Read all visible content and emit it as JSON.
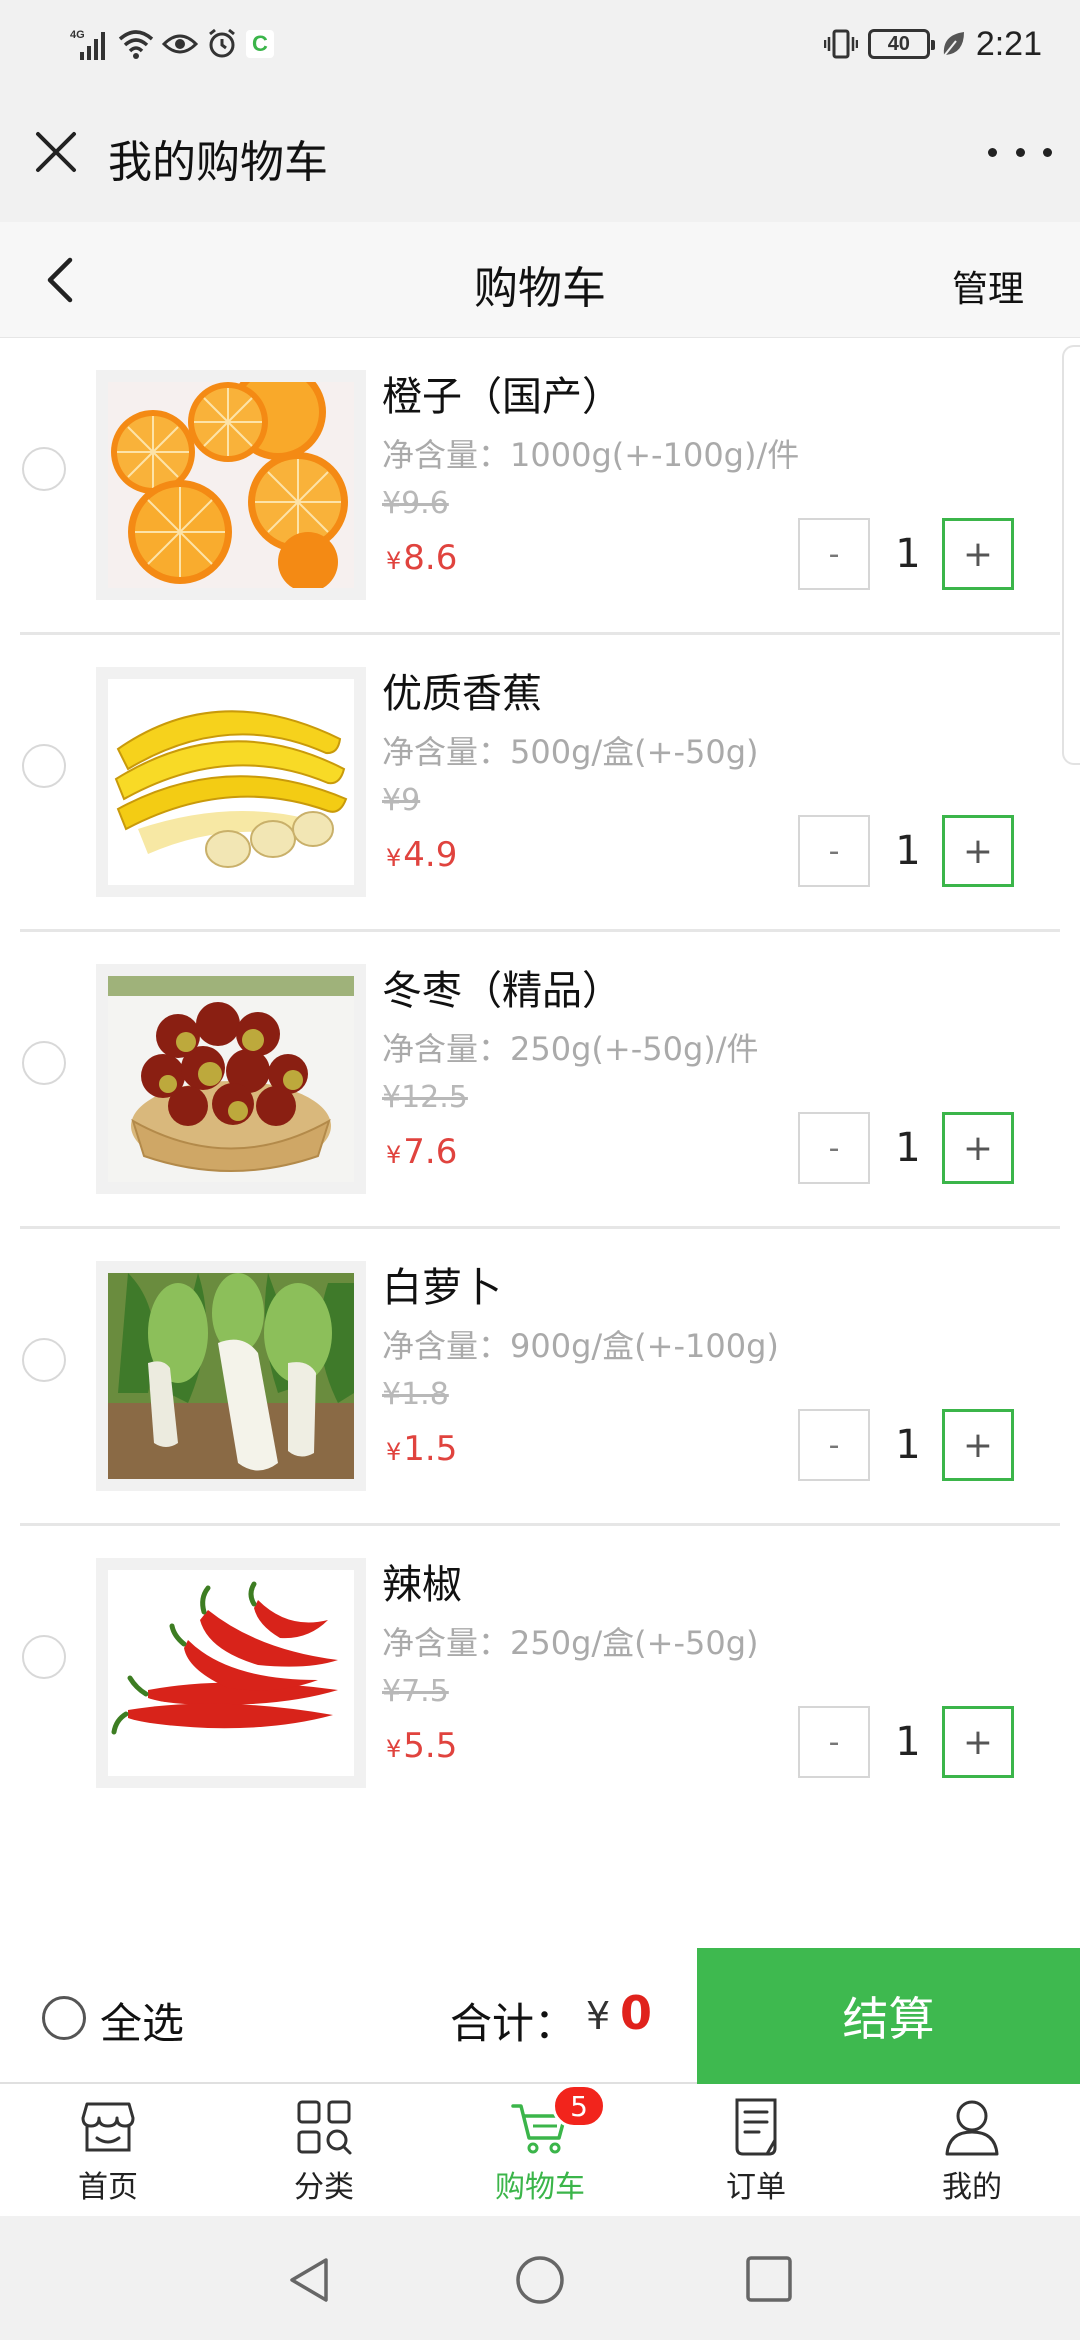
{
  "status_bar": {
    "network": "4G",
    "battery": "40",
    "time": "2:21"
  },
  "titlebar": {
    "title": "我的购物车"
  },
  "navbar": {
    "title": "购物车",
    "manage_label": "管理"
  },
  "cart": {
    "items": [
      {
        "name": "橙子（国产）",
        "spec": "净含量：1000g(+-100g)/件",
        "old_price": "¥9.6",
        "currency": "¥",
        "price": "8.6",
        "quantity": "1",
        "image": "orange"
      },
      {
        "name": "优质香蕉",
        "spec": "净含量：500g/盒(+-50g)",
        "old_price": "¥9",
        "currency": "¥",
        "price": "4.9",
        "quantity": "1",
        "image": "banana"
      },
      {
        "name": "冬枣（精品）",
        "spec": "净含量：250g(+-50g)/件",
        "old_price": "¥12.5",
        "currency": "¥",
        "price": "7.6",
        "quantity": "1",
        "image": "jujube"
      },
      {
        "name": "白萝卜",
        "spec": "净含量：900g/盒(+-100g)",
        "old_price": "¥1.8",
        "currency": "¥",
        "price": "1.5",
        "quantity": "1",
        "image": "radish"
      },
      {
        "name": "辣椒",
        "spec": "净含量：250g/盒(+-50g)",
        "old_price": "¥7.5",
        "currency": "¥",
        "price": "5.5",
        "quantity": "1",
        "image": "chili"
      }
    ],
    "minus_label": "-",
    "plus_label": "+"
  },
  "checkout": {
    "select_all_label": "全选",
    "total_label": "合计：",
    "currency": "¥",
    "total": "0",
    "button_label": "结算"
  },
  "tabbar": {
    "tabs": [
      {
        "label": "首页",
        "icon": "store-icon"
      },
      {
        "label": "分类",
        "icon": "category-grid-icon"
      },
      {
        "label": "购物车",
        "icon": "cart-icon",
        "badge": "5",
        "active": true
      },
      {
        "label": "订单",
        "icon": "order-list-icon"
      },
      {
        "label": "我的",
        "icon": "person-icon"
      }
    ]
  },
  "colors": {
    "accent_green": "#3eb94f",
    "price_red": "#e0433e",
    "badge_red": "#f2241c"
  }
}
